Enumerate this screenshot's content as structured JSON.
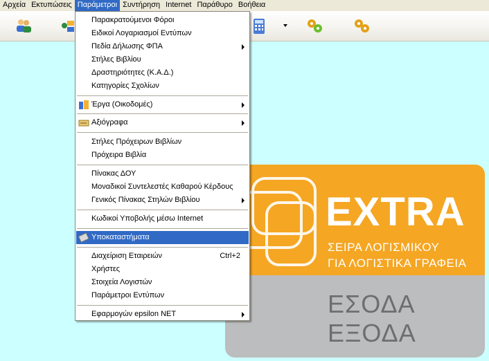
{
  "menubar": {
    "items": [
      "Αρχεία",
      "Εκτυπώσεις",
      "Παράμετροι",
      "Συντήρηση",
      "Internet",
      "Παράθυρο",
      "Βοήθεια"
    ],
    "active_index": 2
  },
  "toolbar": {
    "icons": [
      "users-icon",
      "network-icon",
      "calculator-icon",
      "gears-icon",
      "gears-icon-2"
    ]
  },
  "dropdown": {
    "items": [
      {
        "label": "Παρακρατούμενοι Φόροι"
      },
      {
        "label": "Ειδικοί Λογαριασμοί Εντύπων"
      },
      {
        "label": "Πεδία Δήλωσης ΦΠΑ",
        "submenu": true
      },
      {
        "label": "Στήλες Βιβλίου"
      },
      {
        "label": "Δραστηριότητες (Κ.Α.Δ.)"
      },
      {
        "label": "Κατηγορίες Σχολίων"
      },
      {
        "label": "Έργα (Οικοδομές)",
        "submenu": true,
        "icon": "buildings-icon"
      },
      {
        "label": "Αξιόγραφα",
        "submenu": true,
        "icon": "cheque-icon"
      },
      {
        "label": "Στήλες Πρόχειρων Βιβλίων"
      },
      {
        "label": "Πρόχειρα Βιβλία"
      },
      {
        "label": "Πίνακας ΔΟΥ"
      },
      {
        "label": "Μοναδικοί Συντελεστές Καθαρού Κέρδους"
      },
      {
        "label": "Γενικός Πίνακας Στηλών Βιβλίου",
        "submenu": true
      },
      {
        "label": "Κωδικοί Υποβολής μέσω Internet"
      },
      {
        "label": "Υποκαταστήματα",
        "selected": true,
        "icon": "branch-icon"
      },
      {
        "label": "Διαχείριση Εταιρειών",
        "shortcut": "Ctrl+2"
      },
      {
        "label": "Χρήστες"
      },
      {
        "label": "Στοιχεία Λογιστών"
      },
      {
        "label": "Παράμετροι Εντύπων"
      },
      {
        "label": "Εφαρμογών epsilon NET",
        "submenu": true
      }
    ]
  },
  "logo": {
    "title": "EXTRA",
    "subtitle_line1": "ΣΕΙΡΑ ΛΟΓΙΣΜΙΚΟΥ",
    "subtitle_line2": "ΓΙΑ ΛΟΓΙΣΤΙΚΑ ΓΡΑΦΕΙΑ",
    "line_esoda": "ΕΣΟΔΑ",
    "line_exoda": "ΕΞΟΔΑ",
    "colors": {
      "orange": "#f5a623",
      "gray": "#bcbdbe",
      "text_gray": "#6e6e6e"
    }
  },
  "colors": {
    "desktop_bg": "#ccffff",
    "highlight": "#316ac5"
  }
}
